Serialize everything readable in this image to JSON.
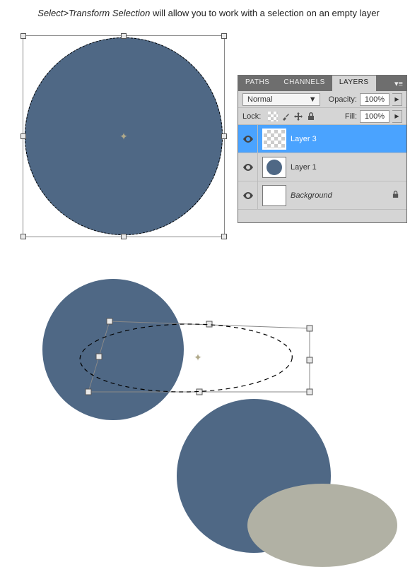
{
  "caption": {
    "menu_path": "Select>Transform Selection",
    "rest": " will allow you to work with a selection on an empty layer"
  },
  "layers_panel": {
    "tabs": {
      "paths": "PATHS",
      "channels": "CHANNELS",
      "layers": "LAYERS"
    },
    "blend_mode": "Normal",
    "opacity_label": "Opacity:",
    "opacity_value": "100%",
    "lock_label": "Lock:",
    "fill_label": "Fill:",
    "fill_value": "100%",
    "layers": [
      {
        "name": "Layer 3",
        "selected": true,
        "visible": true,
        "thumb": "empty"
      },
      {
        "name": "Layer 1",
        "selected": false,
        "visible": true,
        "thumb": "circle"
      },
      {
        "name": "Background",
        "selected": false,
        "visible": true,
        "thumb": "white",
        "locked": true
      }
    ]
  },
  "colors": {
    "blue": "#4f6885",
    "grey_fill": "#b1b1a4"
  }
}
